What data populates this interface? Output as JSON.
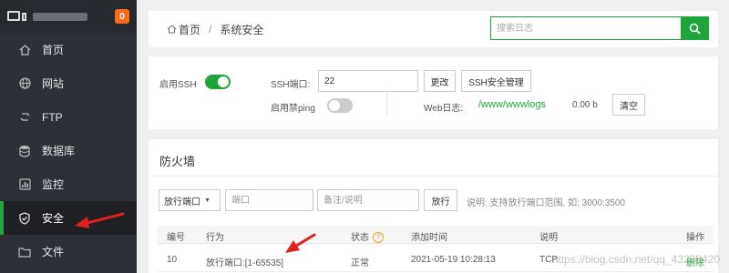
{
  "sidebar": {
    "badge": "0",
    "items": [
      {
        "label": "首页",
        "icon": "home-icon"
      },
      {
        "label": "网站",
        "icon": "globe-icon"
      },
      {
        "label": "FTP",
        "icon": "ftp-icon"
      },
      {
        "label": "数据库",
        "icon": "database-icon"
      },
      {
        "label": "监控",
        "icon": "monitor-icon"
      },
      {
        "label": "安全",
        "icon": "shield-icon",
        "active": true
      },
      {
        "label": "文件",
        "icon": "folder-icon"
      }
    ]
  },
  "breadcrumb": {
    "home": "首页",
    "separator": "/",
    "current": "系统安全"
  },
  "search": {
    "placeholder": "搜索日志"
  },
  "ssh": {
    "enable_label": "启用SSH",
    "port_label": "SSH端口:",
    "port_value": "22",
    "change_button": "更改",
    "manage_button": "SSH安全管理",
    "ping_label": "启用禁ping",
    "weblog_label": "Web日志:",
    "weblog_path": "/www/wwwlogs",
    "weblog_size": "0.00 b",
    "clear_button": "清空"
  },
  "firewall": {
    "title": "防火墙",
    "select_value": "放行端口",
    "port_placeholder": "端口",
    "note_placeholder": "备注/说明",
    "submit_button": "放行",
    "hint": "说明: 支持放行端口范围, 如: 3000:3500",
    "columns": [
      "编号",
      "行为",
      "状态",
      "添加时间",
      "说明",
      "操作"
    ],
    "rows": [
      {
        "id": "10",
        "action": "放行端口:[1-65535]",
        "status": "正常",
        "time": "2021-05-19 10:28:13",
        "note": "TCP",
        "op": "删除"
      }
    ]
  },
  "watermark": "https://blog.csdn.net/qq_43238420",
  "colors": {
    "accent": "#20a53a",
    "sidebar": "#2d3036",
    "badge": "#ff6a1a",
    "arrow": "#e0201c"
  }
}
